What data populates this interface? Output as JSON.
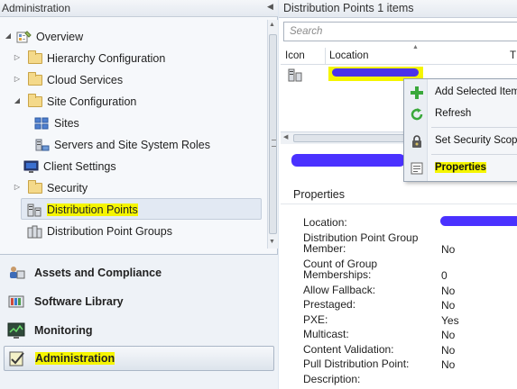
{
  "left_pane": {
    "title": "Administration"
  },
  "tree": {
    "items": [
      {
        "label": "Overview",
        "icon": "overview-icon",
        "expander": "expanded"
      },
      {
        "label": "Hierarchy Configuration",
        "icon": "folder-icon",
        "expander": "collapsed"
      },
      {
        "label": "Cloud Services",
        "icon": "folder-icon",
        "expander": "collapsed"
      },
      {
        "label": "Site Configuration",
        "icon": "folder-icon",
        "expander": "expanded"
      },
      {
        "label": "Sites",
        "icon": "sites-icon"
      },
      {
        "label": "Servers and Site System Roles",
        "icon": "servers-icon"
      },
      {
        "label": "Client Settings",
        "icon": "client-settings-icon"
      },
      {
        "label": "Security",
        "icon": "folder-icon",
        "expander": "collapsed"
      },
      {
        "label": "Distribution Points",
        "icon": "distribution-points-icon",
        "selected": true
      },
      {
        "label": "Distribution Point Groups",
        "icon": "distribution-point-groups-icon"
      }
    ]
  },
  "wunderbar": {
    "items": [
      {
        "label": "Assets and Compliance",
        "icon": "assets-compliance-icon"
      },
      {
        "label": "Software Library",
        "icon": "software-library-icon"
      },
      {
        "label": "Monitoring",
        "icon": "monitoring-icon"
      },
      {
        "label": "Administration",
        "icon": "administration-icon",
        "active": true
      }
    ]
  },
  "right_pane": {
    "title": "Distribution Points 1 items",
    "search_placeholder": "Search",
    "columns": [
      "Icon",
      "Location",
      "T"
    ]
  },
  "context_menu": {
    "items": [
      {
        "label": "Add Selected Items",
        "icon": "add-icon"
      },
      {
        "label": "Refresh",
        "icon": "refresh-icon"
      },
      {
        "label": "Set Security Scopes",
        "icon": "security-scopes-icon"
      },
      {
        "label": "Properties",
        "icon": "properties-icon",
        "highlighted": true
      }
    ]
  },
  "details": {
    "title": "Properties",
    "properties": [
      {
        "label": "Location:",
        "value": ""
      },
      {
        "label": "Distribution Point Group Member:",
        "value": "No"
      },
      {
        "label": "Count of Group Memberships:",
        "value": "0"
      },
      {
        "label": "Allow Fallback:",
        "value": "No"
      },
      {
        "label": "Prestaged:",
        "value": "No"
      },
      {
        "label": "PXE:",
        "value": "Yes"
      },
      {
        "label": "Multicast:",
        "value": "No"
      },
      {
        "label": "Content Validation:",
        "value": "No"
      },
      {
        "label": "Pull Distribution Point:",
        "value": "No"
      },
      {
        "label": "Description:",
        "value": ""
      }
    ]
  },
  "colors": {
    "highlighter": "#f5f500",
    "redaction": "#3b1fff",
    "selection": "#e2e9f3"
  }
}
